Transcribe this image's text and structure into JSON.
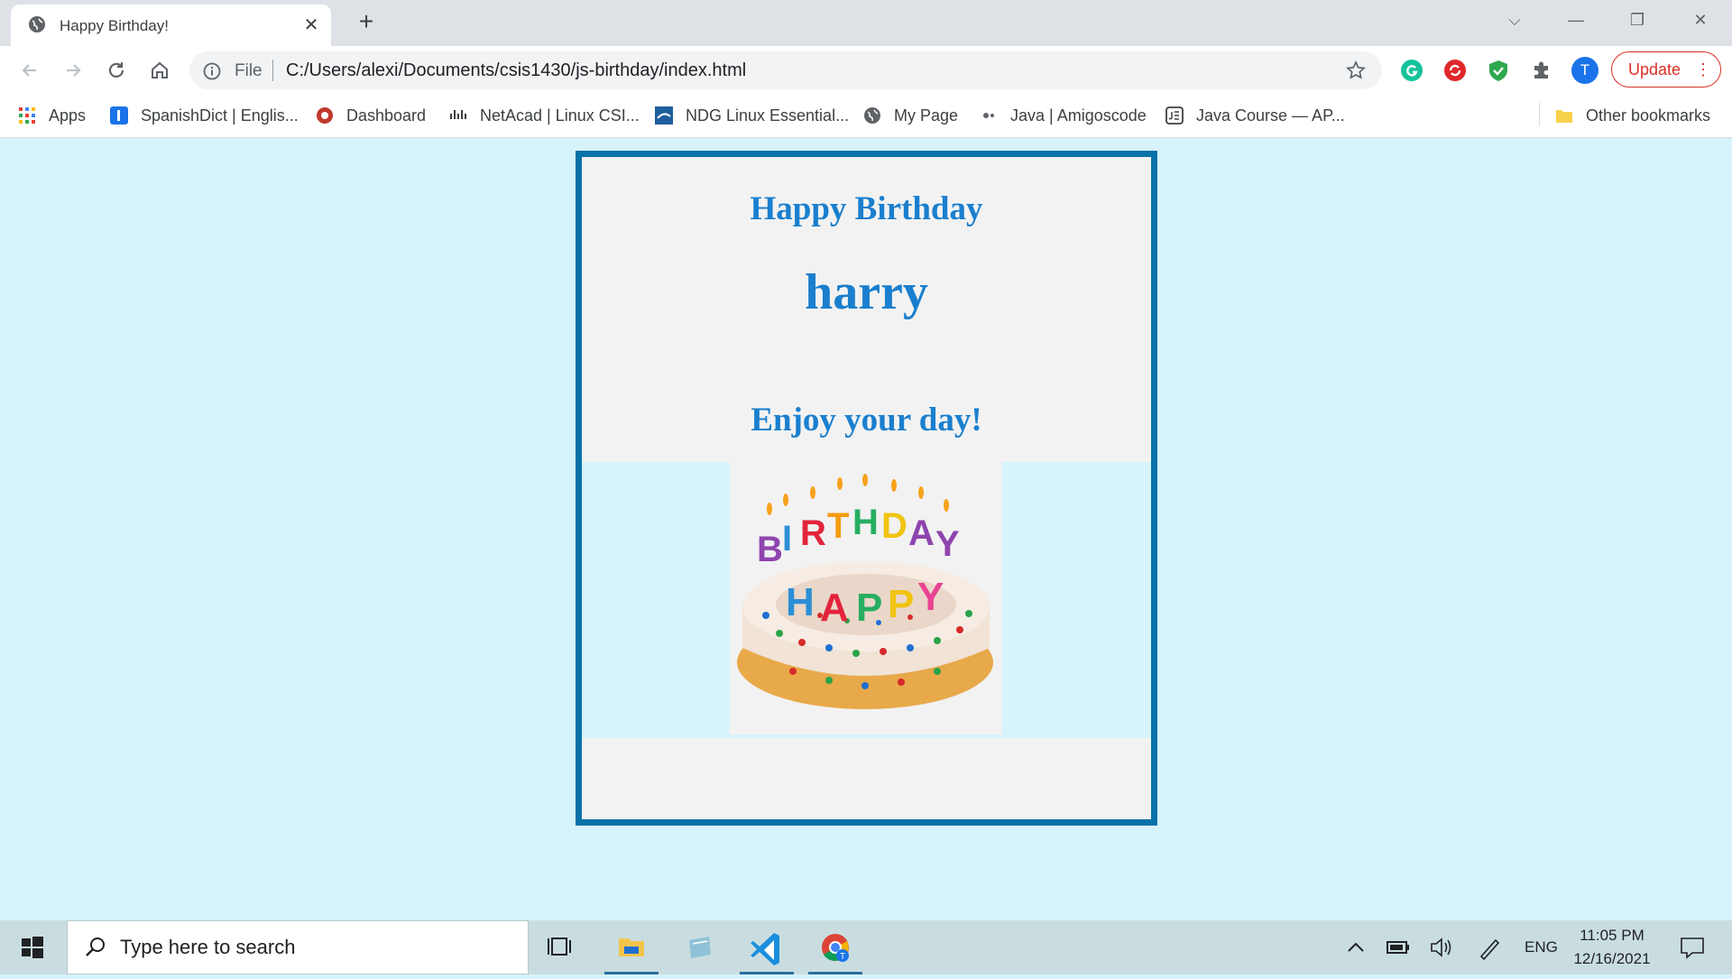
{
  "browser": {
    "tab_title": "Happy Birthday!",
    "url_scheme": "File",
    "url": "C:/Users/alexi/Documents/csis1430/js-birthday/index.html",
    "profile_initial": "T",
    "update_label": "Update"
  },
  "bookmarks": [
    {
      "label": "Apps",
      "icon": "apps-grid-icon"
    },
    {
      "label": "SpanishDict | Englis...",
      "icon": "spanishdict-icon"
    },
    {
      "label": "Dashboard",
      "icon": "dashboard-icon"
    },
    {
      "label": "NetAcad | Linux CSI...",
      "icon": "cisco-icon"
    },
    {
      "label": "NDG Linux Essential...",
      "icon": "ndg-icon"
    },
    {
      "label": "My Page",
      "icon": "globe-icon"
    },
    {
      "label": "Java | Amigoscode",
      "icon": "amigoscode-icon"
    },
    {
      "label": "Java Course — AP...",
      "icon": "java-course-icon"
    }
  ],
  "other_bookmarks": "Other bookmarks",
  "card": {
    "heading": "Happy Birthday",
    "name": "harry",
    "message": "Enjoy your day!",
    "cake_word_top": "BIRTHDAY",
    "cake_word_bottom": "HAPPY"
  },
  "taskbar": {
    "search_placeholder": "Type here to search",
    "language": "ENG",
    "time": "11:05 PM",
    "date": "12/16/2021"
  }
}
